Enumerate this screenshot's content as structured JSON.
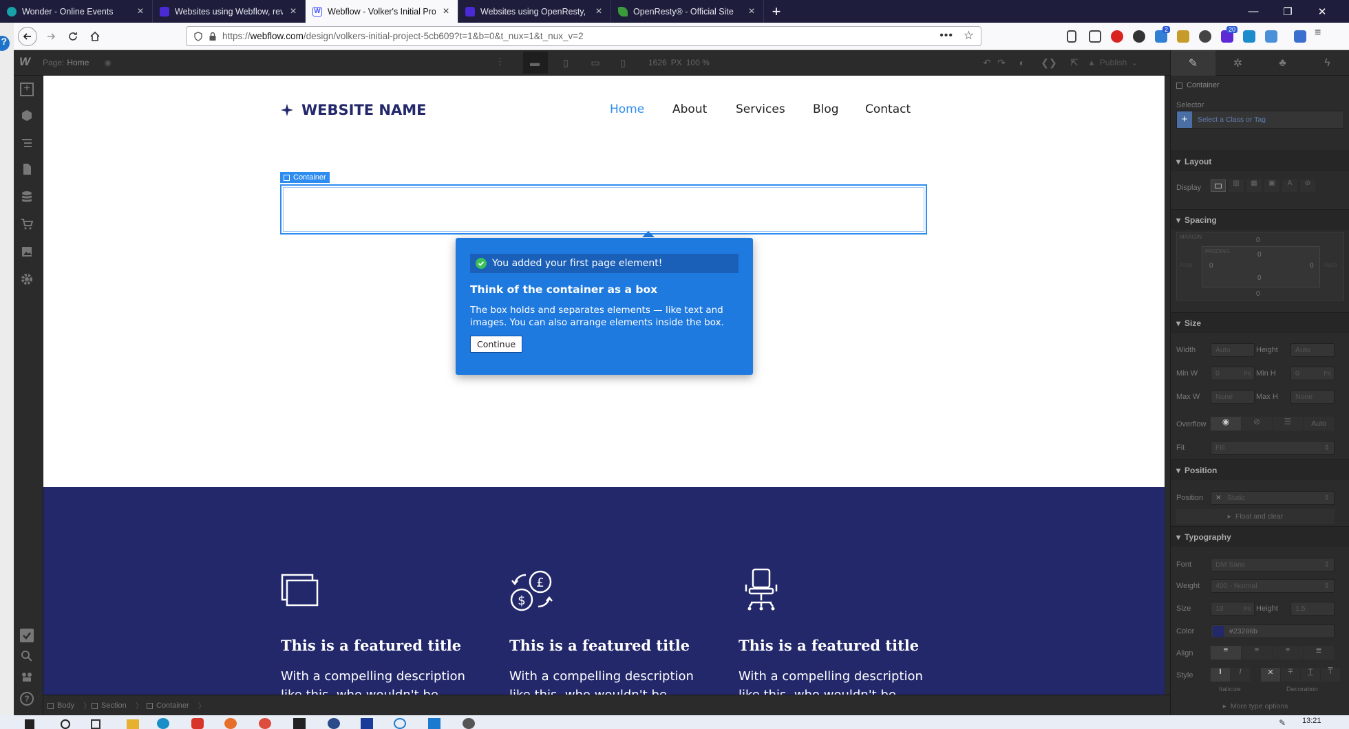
{
  "browser": {
    "tabs": [
      {
        "title": "Wonder - Online Events",
        "color": "#17a2a8"
      },
      {
        "title": "Websites using Webflow, review",
        "color": "#4b2ad6"
      },
      {
        "title": "Webflow - Volker's Initial Project",
        "color": "#4353ff"
      },
      {
        "title": "Websites using OpenResty, revi",
        "color": "#4b2ad6"
      },
      {
        "title": "OpenResty® - Official Site",
        "color": "#3a9b3a"
      }
    ],
    "url_prefix": "https://",
    "url_domain": "webflow.com",
    "url_path": "/design/volkers-initial-project-5cb609?t=1&b=0&t_nux=1&t_nux_v=2",
    "ext_badges": {
      "a": "2",
      "b": "20"
    }
  },
  "designer": {
    "page_label": "Page:",
    "page_name": "Home",
    "canvas_width": "1626",
    "canvas_unit": "PX",
    "zoom": "100 %",
    "publish": "Publish"
  },
  "site": {
    "logo_text": "WEBSITE NAME",
    "nav": [
      "Home",
      "About",
      "Services",
      "Blog",
      "Contact"
    ],
    "container_tag": "Container",
    "features": [
      {
        "title": "This is a featured title",
        "desc_line1": "With a compelling description",
        "desc_line2": "like this, who wouldn't be"
      },
      {
        "title": "This is a featured title",
        "desc_line1": "With a compelling description",
        "desc_line2": "like this, who wouldn't be"
      },
      {
        "title": "This is a featured title",
        "desc_line1": "With a compelling description",
        "desc_line2": "like this, who wouldn't be"
      }
    ]
  },
  "tour": {
    "banner": "You added your first page element!",
    "title": "Think of the container as a box",
    "body": "The box holds and separates elements — like text and images. You can also arrange elements inside the box.",
    "button": "Continue"
  },
  "panel": {
    "element": "Container",
    "selector_label": "Selector",
    "selector_placeholder": "Select a Class or Tag",
    "layout": "Layout",
    "display": "Display",
    "spacing": "Spacing",
    "margin": "MARGIN",
    "padding": "PADDING",
    "zero": "0",
    "auto": "Auto",
    "size": "Size",
    "width": "Width",
    "height": "Height",
    "minw": "Min W",
    "minh": "Min H",
    "maxw": "Max W",
    "maxh": "Max H",
    "none": "None",
    "px": "PX",
    "overflow": "Overflow",
    "fit": "Fit",
    "fit_val": "Fill",
    "position_sec": "Position",
    "position": "Position",
    "position_val": "Static",
    "float": "Float and clear",
    "typography": "Typography",
    "font": "Font",
    "font_val": "DM Sans",
    "weight": "Weight",
    "weight_val": "400 - Normal",
    "tsize": "Size",
    "tsize_val": "18",
    "theight": "Height",
    "theight_val": "1.5",
    "color": "Color",
    "color_val": "#23286b",
    "align": "Align",
    "style": "Style",
    "italicize": "Italicize",
    "decoration": "Decoration",
    "more": "More type options"
  },
  "breadcrumb": [
    "Body",
    "Section",
    "Container"
  ],
  "taskbar": {
    "time": "13:21"
  },
  "colors": {
    "accent": "#2d8cf0",
    "navy": "#23286b",
    "tour": "#1f7ae0"
  }
}
